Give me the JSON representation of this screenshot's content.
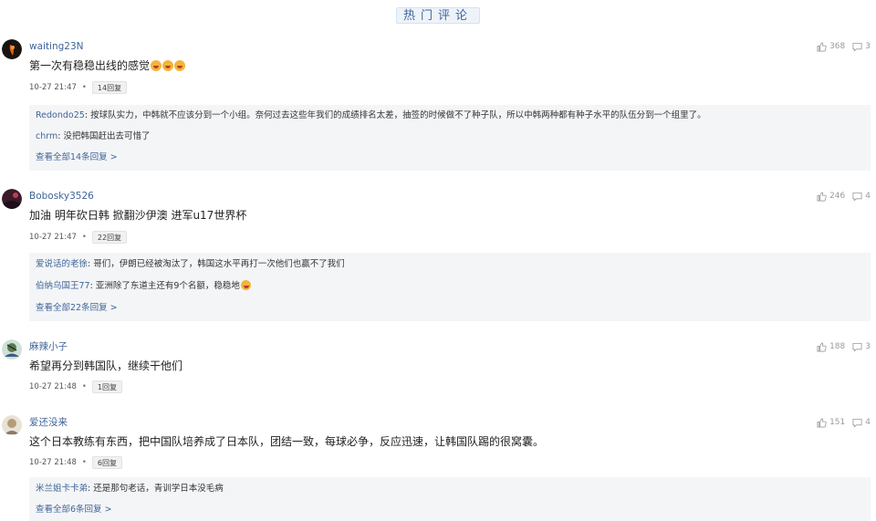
{
  "section_title": "热门评论",
  "comments": [
    {
      "username": "waiting23N",
      "likes": "368",
      "reply_count": "3",
      "text": "第一次有稳稳出线的感觉",
      "time": "10-27 21:47",
      "badge": "14回复",
      "replies": [
        {
          "name": "Redondo25",
          "text": "按球队实力，中韩就不应该分到一个小组。奈何过去这些年我们的成绩排名太差，抽签的时候做不了种子队，所以中韩两种都有种子水平的队伍分到一个组里了。"
        },
        {
          "name": "chrm",
          "text": "没把韩国赶出去可惜了"
        }
      ],
      "view_all": "查看全部14条回复 >"
    },
    {
      "username": "Bobosky3526",
      "likes": "246",
      "reply_count": "4",
      "text": "加油 明年砍日韩 掀翻沙伊澳 进军u17世界杯",
      "time": "10-27 21:47",
      "badge": "22回复",
      "replies": [
        {
          "name": "爱说话的老徐",
          "text": "哥们，伊朗已经被淘汰了，韩国这水平再打一次他们也赢不了我们"
        },
        {
          "name": "伯纳乌国王77",
          "text": "亚洲除了东道主还有9个名额，稳稳地"
        }
      ],
      "view_all": "查看全部22条回复 >"
    },
    {
      "username": "麻辣小子",
      "likes": "188",
      "reply_count": "3",
      "text": "希望再分到韩国队，继续干他们",
      "time": "10-27 21:48",
      "badge": "1回复",
      "replies": [],
      "view_all": ""
    },
    {
      "username": "爱还没来",
      "likes": "151",
      "reply_count": "4",
      "text": "这个日本教练有东西，把中国队培养成了日本队，团结一致，每球必争，反应迅速，让韩国队踢的很窝囊。",
      "time": "10-27 21:48",
      "badge": "6回复",
      "replies": [
        {
          "name": "米兰姐卡卡弟",
          "text": "还是那句老话，青训学日本没毛病"
        }
      ],
      "view_all": "查看全部6条回复 >"
    }
  ]
}
